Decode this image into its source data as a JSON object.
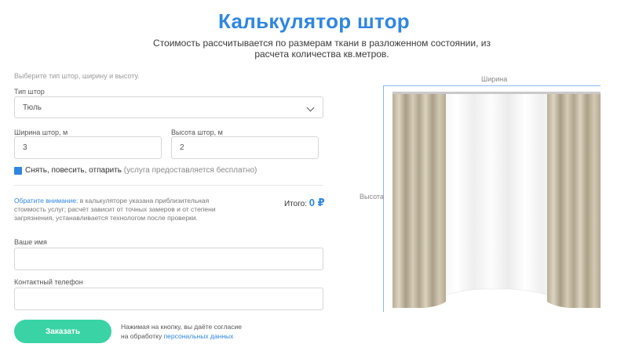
{
  "header": {
    "title": "Калькулятор штор",
    "subtitle": "Стоимость рассчитывается по размерам ткани в разложенном состоянии, из расчета количества кв.метров."
  },
  "form": {
    "hint": "Выберите тип штор, ширину и высоту.",
    "type_label": "Тип штор",
    "type_value": "Тюль",
    "width_label": "Ширина штор, м",
    "width_value": "3",
    "height_label": "Высота штор, м",
    "height_value": "2",
    "service_checked": true,
    "service_label": "Снять, повесить, отпарить",
    "service_note": "(услуга предоставляется бесплатно)",
    "note_accent": "Обратите внимание:",
    "note_text": "в калькуляторе указана приблизительная стоимость услуг; расчёт зависит от точных замеров и от степени загрязнения, устанавливается технологом после проверки.",
    "total_label": "Итого:",
    "total_value": "0 ₽",
    "name_label": "Ваше имя",
    "name_value": "",
    "phone_label": "Контактный телефон",
    "phone_value": "",
    "order_button": "Заказать",
    "consent_text": "Нажимая на кнопку, вы даёте согласие",
    "consent_prefix": "на обработку",
    "consent_link": "персональных данных"
  },
  "preview": {
    "width_label": "Ширина",
    "height_label": "Высота"
  },
  "colors": {
    "accent": "#2f86e0",
    "button": "#3ad3a5"
  }
}
